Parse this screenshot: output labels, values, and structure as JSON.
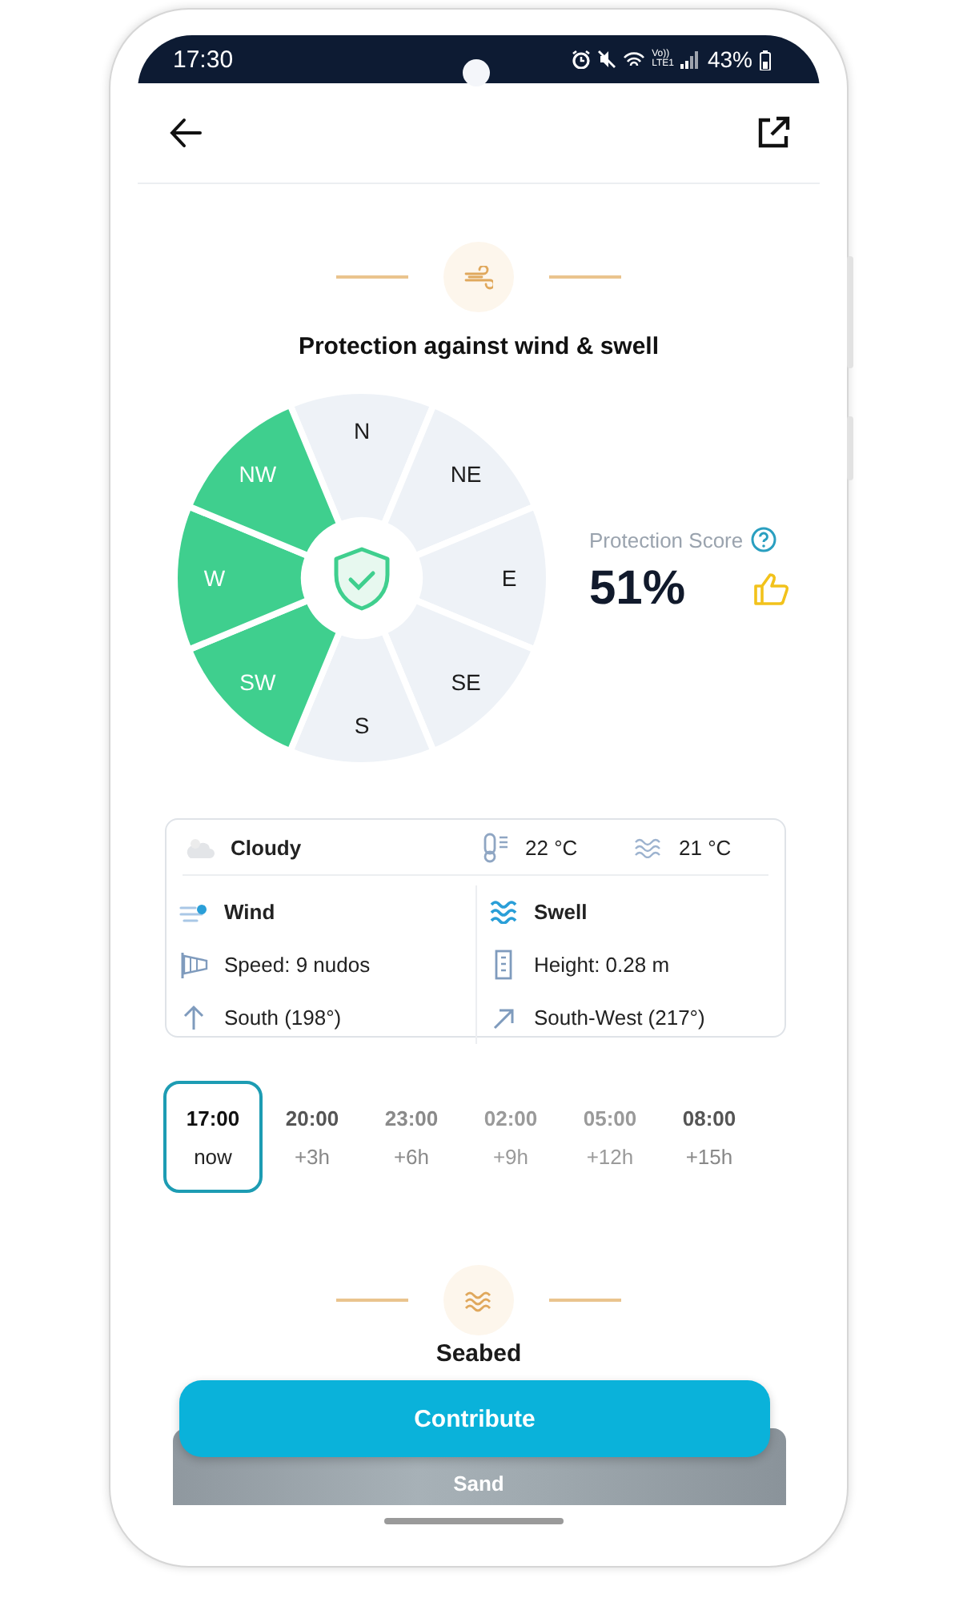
{
  "status_bar": {
    "time": "17:30",
    "network": [
      "Vo))",
      "LTE1"
    ],
    "battery": "43%"
  },
  "wind_section": {
    "title": "Protection against wind & swell"
  },
  "wind_rose": {
    "sectors": [
      {
        "label": "N",
        "protected": false
      },
      {
        "label": "NE",
        "protected": false
      },
      {
        "label": "E",
        "protected": false
      },
      {
        "label": "SE",
        "protected": false
      },
      {
        "label": "S",
        "protected": false
      },
      {
        "label": "SW",
        "protected": true
      },
      {
        "label": "W",
        "protected": true
      },
      {
        "label": "NW",
        "protected": true
      }
    ]
  },
  "protection_score": {
    "label": "Protection Score",
    "value": "51%"
  },
  "conditions": {
    "sky": "Cloudy",
    "air_temp": "22 °C",
    "water_temp": "21 °C",
    "wind": {
      "title": "Wind",
      "speed": "Speed: 9 nudos",
      "direction": "South (198°)"
    },
    "swell": {
      "title": "Swell",
      "height": "Height: 0.28 m",
      "direction": "South-West (217°)"
    }
  },
  "forecast": [
    {
      "time": "17:00",
      "offset": "now",
      "selected": true
    },
    {
      "time": "20:00",
      "offset": "+3h",
      "selected": false
    },
    {
      "time": "23:00",
      "offset": "+6h",
      "selected": false
    },
    {
      "time": "02:00",
      "offset": "+9h",
      "selected": false
    },
    {
      "time": "05:00",
      "offset": "+12h",
      "selected": false
    },
    {
      "time": "08:00",
      "offset": "+15h",
      "selected": false
    }
  ],
  "seabed": {
    "title": "Seabed",
    "type": "Sand"
  },
  "contribute_button": "Contribute"
}
